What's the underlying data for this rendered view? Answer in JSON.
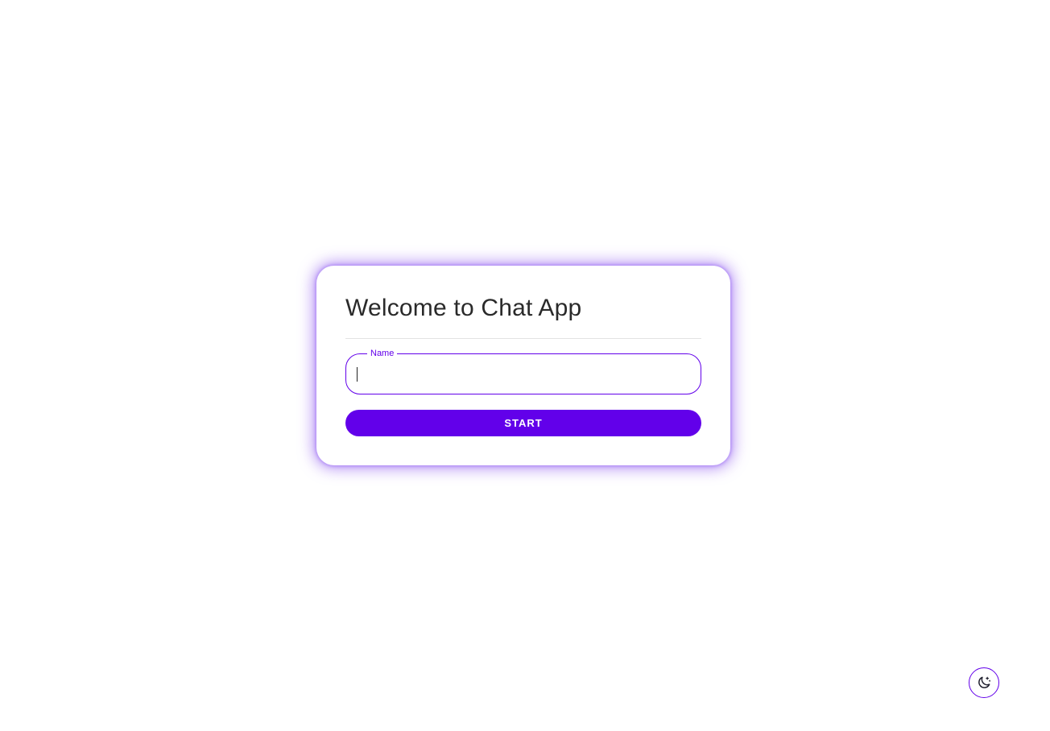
{
  "card": {
    "title": "Welcome to Chat App",
    "name_field": {
      "label": "Name",
      "value": "",
      "placeholder": ""
    },
    "start_button_label": "START"
  },
  "theme_toggle": {
    "icon": "moon-stars-icon"
  },
  "colors": {
    "accent": "#6200ea",
    "card_glow": "#8b5cf6",
    "title_text": "#2a2a2a",
    "background": "#ffffff"
  }
}
